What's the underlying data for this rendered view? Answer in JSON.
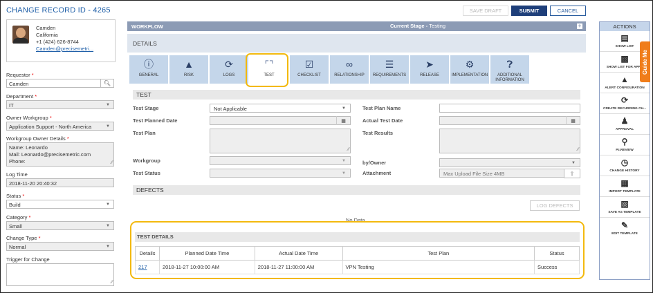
{
  "header": {
    "record_id": "CHANGE RECORD ID - 4265",
    "save_draft": "SAVE DRAFT",
    "submit": "SUBMIT",
    "cancel": "CANCEL"
  },
  "user": {
    "name": "Camden",
    "location": "California",
    "phone": "+1 (424) 626-8744",
    "email": "Camden@precisemetri..."
  },
  "form": {
    "requestor_label": "Requestor",
    "requestor_value": "Camden",
    "department_label": "Department",
    "department_value": "IT",
    "owner_workgroup_label": "Owner Workgroup",
    "owner_workgroup_value": "Application Support - North America",
    "workgroup_owner_label": "Workgroup Owner Details",
    "workgroup_owner_lines": [
      "Name: Leonardo",
      "Mail: Leonardo@precisemetric.com",
      "Phone:"
    ],
    "log_time_label": "Log Time",
    "log_time_value": "2018-11-20 20:40:32",
    "status_label": "Status",
    "status_value": "Build",
    "category_label": "Category",
    "category_value": "Small",
    "change_type_label": "Change Type",
    "change_type_value": "Normal",
    "trigger_label": "Trigger for Change",
    "required_mark": "*"
  },
  "workflow": {
    "title": "WORKFLOW",
    "stage_prefix": "Current Stage -",
    "stage_value": "Testing",
    "details_label": "DETAILS"
  },
  "tabs": [
    {
      "label": "GENERAL",
      "icon": "info-icon"
    },
    {
      "label": "RISK",
      "icon": "warning-icon"
    },
    {
      "label": "LOGS",
      "icon": "logs-icon"
    },
    {
      "label": "TEST",
      "icon": "flask-icon"
    },
    {
      "label": "CHECKLIST",
      "icon": "checklist-icon"
    },
    {
      "label": "RELATIONSHIP",
      "icon": "link-icon"
    },
    {
      "label": "REQUIREMENTS",
      "icon": "requirements-icon"
    },
    {
      "label": "RELEASE",
      "icon": "release-icon"
    },
    {
      "label": "IMPLEMENTATION",
      "icon": "implementation-icon"
    },
    {
      "label": "ADDITIONAL INFORMATION",
      "icon": "question-icon"
    }
  ],
  "test": {
    "section_title": "TEST",
    "test_stage_label": "Test Stage",
    "test_stage_value": "Not Applicable",
    "planned_date_label": "Test Planned Date",
    "test_plan_label": "Test Plan",
    "workgroup_label": "Workgroup",
    "test_status_label": "Test Status",
    "plan_name_label": "Test Plan Name",
    "actual_date_label": "Actual Test Date",
    "results_label": "Test Results",
    "by_owner_label": "by/Owner",
    "attachment_label": "Attachment",
    "attachment_hint": "Max Upload File Size 4MB"
  },
  "defects": {
    "section_title": "DEFECTS",
    "log_defects": "LOG DEFECTS",
    "no_data": "No Data"
  },
  "test_details": {
    "title": "TEST DETAILS",
    "columns": [
      "Details",
      "Planned Date Time",
      "Actual Date Time",
      "Test Plan",
      "Status"
    ],
    "rows": [
      [
        "217",
        "2018-11-27 10:00:00 AM",
        "2018-11-27 11:00:00 AM",
        "VPN Testing",
        "Success"
      ]
    ]
  },
  "actions": {
    "title": "ACTIONS",
    "items": [
      {
        "label": "SHOW LIST",
        "icon": "list-icon"
      },
      {
        "label": "SHOW LIST FOR APPR",
        "icon": "list-approval-icon"
      },
      {
        "label": "ALERT CONFIGURATION",
        "icon": "alert-icon"
      },
      {
        "label": "CREATE RECURRING CH...",
        "icon": "recurring-icon"
      },
      {
        "label": "APPROVAL",
        "icon": "approval-icon"
      },
      {
        "label": "P.I.REVIEW",
        "icon": "review-icon"
      },
      {
        "label": "CHANGE HISTORY",
        "icon": "history-icon"
      },
      {
        "label": "IMPORT TEMPLATE",
        "icon": "import-icon"
      },
      {
        "label": "SAVE AS TEMPLATE",
        "icon": "save-template-icon"
      },
      {
        "label": "EDIT TEMPLATE",
        "icon": "edit-template-icon"
      }
    ]
  },
  "guide_me": "Guide Me",
  "colors": {
    "brand": "#1f5fa8",
    "highlight": "#f3b90d",
    "guide": "#f07d1a",
    "workflow_bar": "#8c9bb5"
  }
}
